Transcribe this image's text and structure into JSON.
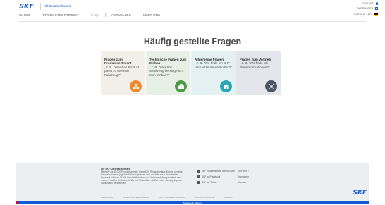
{
  "header": {
    "logo": "SKF",
    "subtitle": "Kfz-Ersatzteilmarkt",
    "util": {
      "contact": "KONTAKT",
      "cart": "WARENKORB",
      "country": "DEUTSCHLAND"
    }
  },
  "nav": {
    "items": [
      {
        "label": "SUCHE",
        "active": false
      },
      {
        "label": "PRODUKTSORTIMENT",
        "active": false
      },
      {
        "label": "FAQS",
        "active": true
      },
      {
        "label": "AKTUELLES",
        "active": false
      },
      {
        "label": "ÜBER UNS",
        "active": false
      }
    ]
  },
  "main": {
    "title": "Häufig gestellte Fragen",
    "cards": [
      {
        "heading": "Fragen zum Produktsortiment",
        "body": ", z. B. \"Welches Produkt passt zu meinem Fahrzeug?\"",
        "icon": "boxes-icon",
        "color": "#f0882e"
      },
      {
        "heading": "Technische Fragen zum Einbau",
        "body": ", z. B. \"Welches Werkzeug benötige ich zum Einbau?\"",
        "icon": "toolbox-icon",
        "color": "#4a9a47"
      },
      {
        "heading": "Allgemeine Fragen",
        "body": ", z. B. \"Wo finde ich SKF Verkaufsstellen/Händler?\"",
        "icon": "store-icon",
        "color": "#29a6b3"
      },
      {
        "heading": "Fragen zum Vertrieb",
        "body": ", z. B. \"Wo finde ich Preisinformationen?\"",
        "icon": "network-icon",
        "color": "#4a5566"
      }
    ]
  },
  "footer": {
    "about_title": "Der SKF Kfz-Ersatzteilmarkt",
    "about_text": "Mit mehr als 30.000 Produktnummern bietet SKF Reparatursätze für eine perfekte Reparatur nahezu jeglicher Fahrzeugmarken und -modelle aus. Unser starkes Netzwerk mit über 10.000 Ersatzteilhändlern und Vertriebsstellen garantiert, dass unsere Produkte für Autos, LKWs und Motorräder mit Zeit in der nächstgelegenen Werkstätten bereitstehen.",
    "social": [
      {
        "label": "SKF Ersatzteilmarkt auf YouTube",
        "icon": "youtube-icon"
      },
      {
        "label": "SKF auf Facebook",
        "icon": "facebook-icon"
      },
      {
        "label": "SKF auf Twitter",
        "icon": "twitter-icon"
      }
    ],
    "links": [
      "SKF.com ›",
      "Investoren ›",
      "Karriere ›"
    ],
    "logo": "SKF",
    "bottom_links": [
      "IMPRESSUM",
      "DATENSCHUTZERKLÄRUNG",
      "NUTZUNGSBEDINGUNGEN",
      "COOKIE-RICHTLINIE",
      "SITEMAP"
    ],
    "bar_text": "Bedeutet ein Stillegen"
  },
  "colors": {
    "brand": "#0f58d6",
    "accent_red": "#e4001b"
  }
}
